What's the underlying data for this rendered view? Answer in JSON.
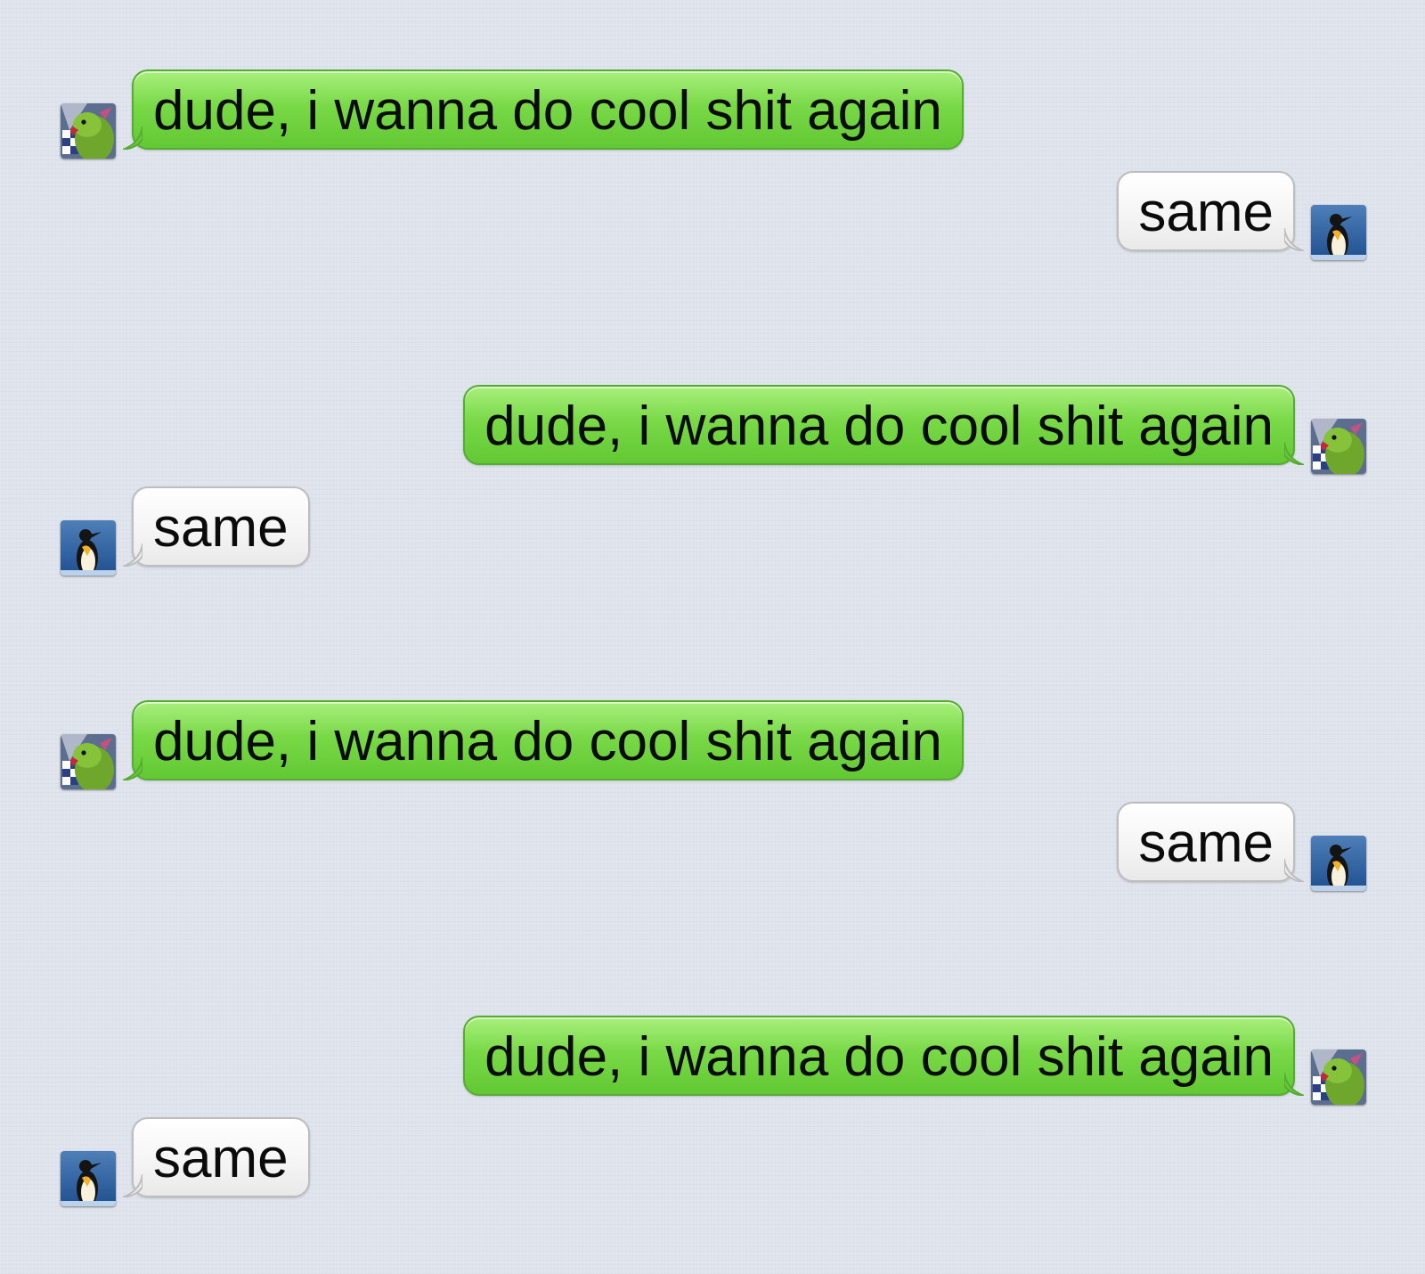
{
  "messages": [
    {
      "text": "dude, i wanna do cool shit again",
      "style": "green",
      "side": "left",
      "avatar": "parrot-avatar"
    },
    {
      "text": "same",
      "style": "white",
      "side": "right",
      "avatar": "penguin-avatar"
    },
    {
      "text": "dude, i wanna do cool shit again",
      "style": "green",
      "side": "right",
      "avatar": "parrot-avatar"
    },
    {
      "text": "same",
      "style": "white",
      "side": "left",
      "avatar": "penguin-avatar"
    },
    {
      "text": "dude, i wanna do cool shit again",
      "style": "green",
      "side": "left",
      "avatar": "parrot-avatar"
    },
    {
      "text": "same",
      "style": "white",
      "side": "right",
      "avatar": "penguin-avatar"
    },
    {
      "text": "dude, i wanna do cool shit again",
      "style": "green",
      "side": "right",
      "avatar": "parrot-avatar"
    },
    {
      "text": "same",
      "style": "white",
      "side": "left",
      "avatar": "penguin-avatar"
    }
  ],
  "colors": {
    "background": "#dfe3ec",
    "green_bubble": "#79d947",
    "white_bubble": "#f4f4f4"
  }
}
